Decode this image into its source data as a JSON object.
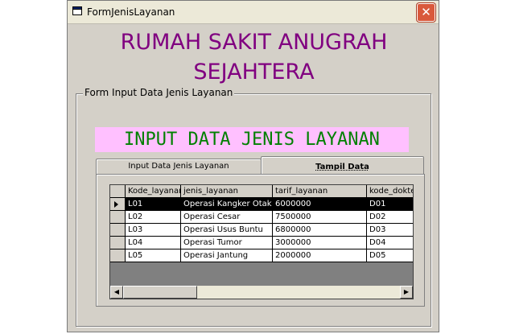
{
  "window": {
    "title": "FormJenisLayanan",
    "close_symbol": "✕"
  },
  "heading": {
    "line1": "RUMAH SAKIT ANUGRAH",
    "line2": "SEJAHTERA"
  },
  "frame": {
    "label": "Form Input Data Jenis Layanan"
  },
  "banner": {
    "text": "INPUT DATA JENIS LAYANAN"
  },
  "tabs": [
    {
      "label": "Input Data Jenis Layanan",
      "active": false
    },
    {
      "label": "Tampil Data",
      "active": true
    }
  ],
  "grid": {
    "columns": [
      "Kode_layanan",
      "jenis_layanan",
      "tarif_layanan",
      "kode_dokter"
    ],
    "rows": [
      [
        "L01",
        "Operasi Kangker Otak",
        "6000000",
        "D01"
      ],
      [
        "L02",
        "Operasi Cesar",
        "7500000",
        "D02"
      ],
      [
        "L03",
        "Operasi Usus Buntu",
        "6800000",
        "D03"
      ],
      [
        "L04",
        "Operasi Tumor",
        "3000000",
        "D04"
      ],
      [
        "L05",
        "Operasi Jantung",
        "2000000",
        "D05"
      ]
    ],
    "selected_row": 0
  },
  "scrollbar": {
    "left_arrow": "◀",
    "right_arrow": "▶"
  }
}
